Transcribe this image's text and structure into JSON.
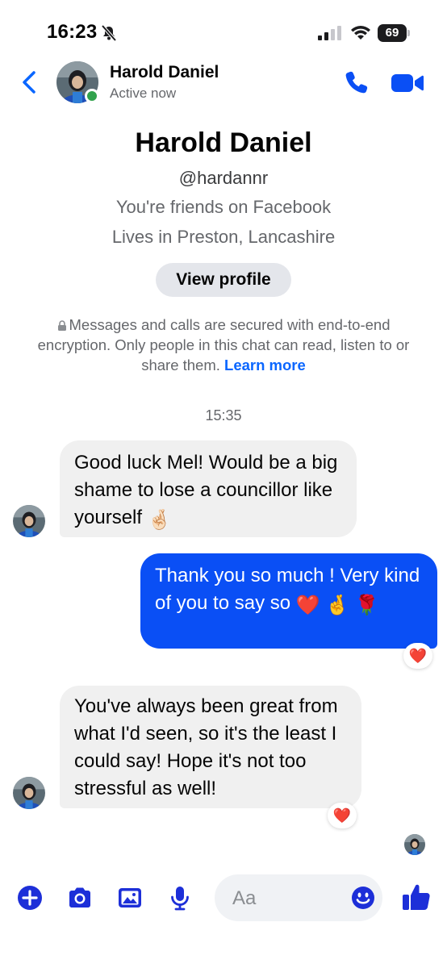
{
  "status_bar": {
    "time": "16:23",
    "battery": "69"
  },
  "header": {
    "name": "Harold Daniel",
    "status": "Active now"
  },
  "profile": {
    "name": "Harold Daniel",
    "handle": "@hardannr",
    "friends": "You're friends on Facebook",
    "location": "Lives in Preston, Lancashire",
    "view_profile_label": "View profile"
  },
  "encryption": {
    "text": "Messages and calls are secured with end-to-end encryption. Only people in this chat can read, listen to or share them.",
    "learn_more": "Learn more"
  },
  "conversation": {
    "timestamp": "15:35",
    "messages": [
      {
        "from": "Harold Daniel",
        "text": "Good luck Mel! Would be a big shame to lose a councillor like yourself",
        "emoji": "🤞🏻"
      },
      {
        "from": "me",
        "text": "Thank you so much ! Very kind of you to say so",
        "emoji": "❤️ 🤞",
        "emoji_2": "🌹",
        "reaction": "❤️"
      },
      {
        "from": "Harold Daniel",
        "text": "You've always been great from what I'd seen, so it's the least I could say! Hope it's not too stressful as well!",
        "reaction": "❤️"
      }
    ]
  },
  "composer": {
    "placeholder": "Aa"
  },
  "colors": {
    "accent": "#0a66ff",
    "outgoing_bubble": "#0a4ff5",
    "incoming_bubble": "#f0f0f0",
    "icon_blue": "#1d2fd8",
    "online": "#31a24c"
  },
  "icons": [
    "bell-slash-icon",
    "cellular-signal-icon",
    "wifi-icon",
    "battery-icon",
    "back-chevron-icon",
    "phone-icon",
    "video-camera-icon",
    "lock-icon",
    "plus-circle-icon",
    "camera-icon",
    "gallery-icon",
    "microphone-icon",
    "smiley-icon",
    "thumbs-up-icon"
  ]
}
